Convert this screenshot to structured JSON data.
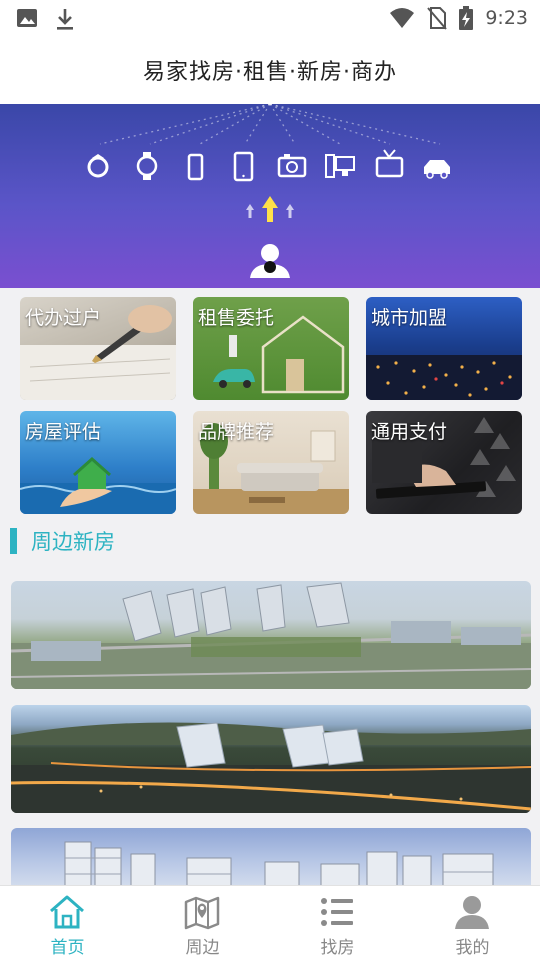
{
  "status_bar": {
    "time": "9:23",
    "icons": [
      "image-icon",
      "download-icon",
      "wifi-icon",
      "no-sim-icon",
      "battery-charging-icon"
    ]
  },
  "header": {
    "title": "易家找房·租售·新房·商办"
  },
  "banner": {
    "icons": [
      "ring-icon",
      "watch-icon",
      "phone-icon",
      "tablet-icon",
      "camera-icon",
      "computer-icon",
      "tv-icon",
      "car-icon",
      "up-arrow-icon",
      "user-icon"
    ],
    "colors": {
      "top": "#3a47a8",
      "bottom": "#7a4fd0"
    }
  },
  "services": [
    {
      "label": "代办过户"
    },
    {
      "label": "租售委托"
    },
    {
      "label": "城市加盟"
    },
    {
      "label": "房屋评估"
    },
    {
      "label": "品牌推荐"
    },
    {
      "label": "通用支付"
    }
  ],
  "section": {
    "title": "周边新房",
    "accent": "#2db3c2"
  },
  "bottom_nav": {
    "items": [
      {
        "label": "首页",
        "icon": "home-icon",
        "active": true
      },
      {
        "label": "周边",
        "icon": "map-icon",
        "active": false
      },
      {
        "label": "找房",
        "icon": "list-icon",
        "active": false
      },
      {
        "label": "我的",
        "icon": "profile-icon",
        "active": false
      }
    ],
    "active_color": "#2db3c2",
    "inactive_color": "#888888"
  }
}
